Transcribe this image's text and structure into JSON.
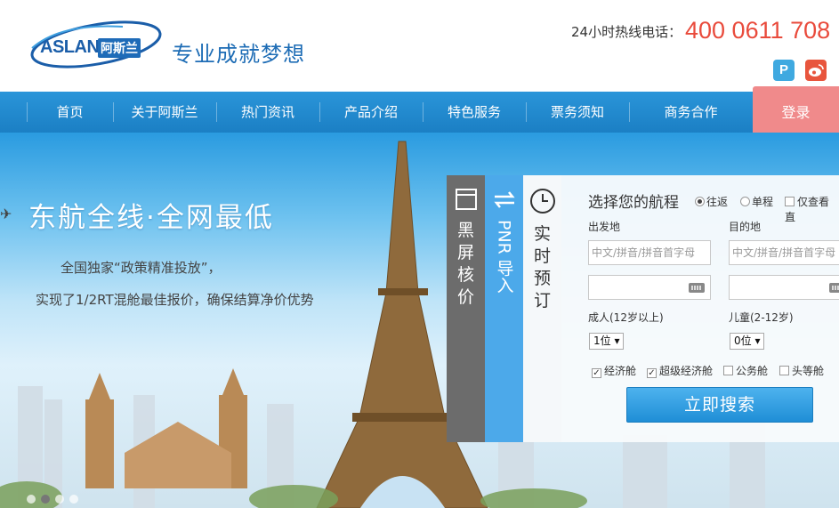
{
  "header": {
    "logo_en": "ASLAN",
    "logo_cn": "阿斯兰",
    "slogan": "专业成就梦想",
    "hotline_label": "24小时热线电话：",
    "hotline_number": "400 0611 708",
    "social": [
      {
        "name": "pinterest-icon",
        "glyph": "P"
      },
      {
        "name": "weibo-icon",
        "glyph": "微"
      }
    ]
  },
  "nav": {
    "items": [
      "首页",
      "关于阿斯兰",
      "热门资讯",
      "产品介绍",
      "特色服务",
      "票务须知",
      "商务合作"
    ],
    "login": "登录"
  },
  "hero": {
    "headline": "东航全线·全网最低",
    "sub1": "全国独家“政策精准投放”，",
    "sub2": "实现了1/2RT混舱最佳报价，确保结算净价优势"
  },
  "tabs": [
    {
      "label": "黑屏核价",
      "icon": "window-icon"
    },
    {
      "label": "PNR 导入",
      "icon": "refresh-icon"
    },
    {
      "label": "实时预订",
      "icon": "clock-icon"
    }
  ],
  "booking": {
    "title": "选择您的航程",
    "trip_types": [
      {
        "label": "往返",
        "selected": true
      },
      {
        "label": "单程",
        "selected": false
      }
    ],
    "direct_only_label": "仅查看直",
    "departure_label": "出发地",
    "destination_label": "目的地",
    "city_placeholder": "中文/拼音/拼音首字母",
    "adult_label": "成人(12岁以上)",
    "child_label": "儿童(2-12岁)",
    "adult_value": "1位 ▾",
    "child_value": "0位 ▾",
    "cabins": [
      {
        "label": "经济舱",
        "checked": true
      },
      {
        "label": "超级经济舱",
        "checked": true
      },
      {
        "label": "公务舱",
        "checked": false
      },
      {
        "label": "头等舱",
        "checked": false
      }
    ],
    "search_button": "立即搜索"
  },
  "colors": {
    "nav_blue": "#2a95d9",
    "login_pink": "#f08a8b",
    "hotline_red": "#e94b3c",
    "brand_blue": "#1d6cb5"
  }
}
